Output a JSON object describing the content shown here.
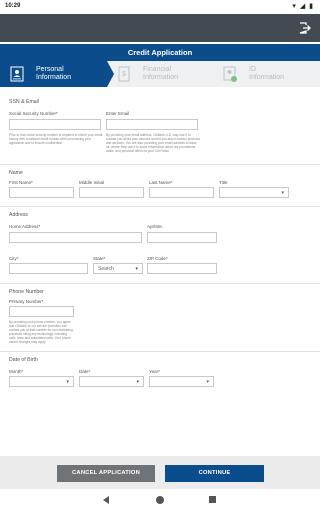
{
  "status": {
    "time": "10:29",
    "system_icons": "▾ ◢ ▮"
  },
  "appbar": {
    "exit_icon": "exit-icon"
  },
  "header": {
    "title": "Credit Application"
  },
  "tabs": [
    {
      "label": "Personal\nInformation",
      "state": "active"
    },
    {
      "label": "Financial\nInformation",
      "state": "inactive"
    },
    {
      "label": "ID\nInformation",
      "state": "inactive"
    }
  ],
  "ssn_email": {
    "section": "SSN & Email",
    "ssn_label": "Social Security Number",
    "ssn_help": "Prior to that social security number is required to check your credit history with a national credit bureau when processing your application and to ensure confidential.",
    "email_label": "Enter Email",
    "email_help": "By providing your email address, Citibank N.A. may use it to contact you about your account and let you about various products and services. You are also providing your email address to allow us, where they use it to serve information about our promotions, deals, and personal offers on your Citi Retail."
  },
  "name": {
    "section": "Name",
    "first": "First Name",
    "middle": "Middle Initial",
    "last": "Last Name",
    "title": "Title"
  },
  "address": {
    "section": "Address",
    "home": "Home Address",
    "apt": "Apt/Ste.",
    "city": "City",
    "state": "State",
    "state_value": "Search",
    "zip": "ZIP Code"
  },
  "phone": {
    "section": "Phone Number",
    "primary": "Primary Number",
    "help": "By providing your phone number, you agree that Citibank or our service providers can contact you at that number for non-marketing purposes using any technology, including calls, texts and autodialed calls. Your phone carrier charges may apply."
  },
  "dob": {
    "section": "Date of Birth",
    "month": "Month",
    "date": "Date",
    "year": "Year"
  },
  "footer": {
    "cancel": "CANCEL APPLICATION",
    "continue": "CONTINUE"
  },
  "colors": {
    "brand": "#0b4d8c",
    "appbar": "#444a52",
    "required": "#c8102e",
    "cancel": "#6e7378"
  }
}
